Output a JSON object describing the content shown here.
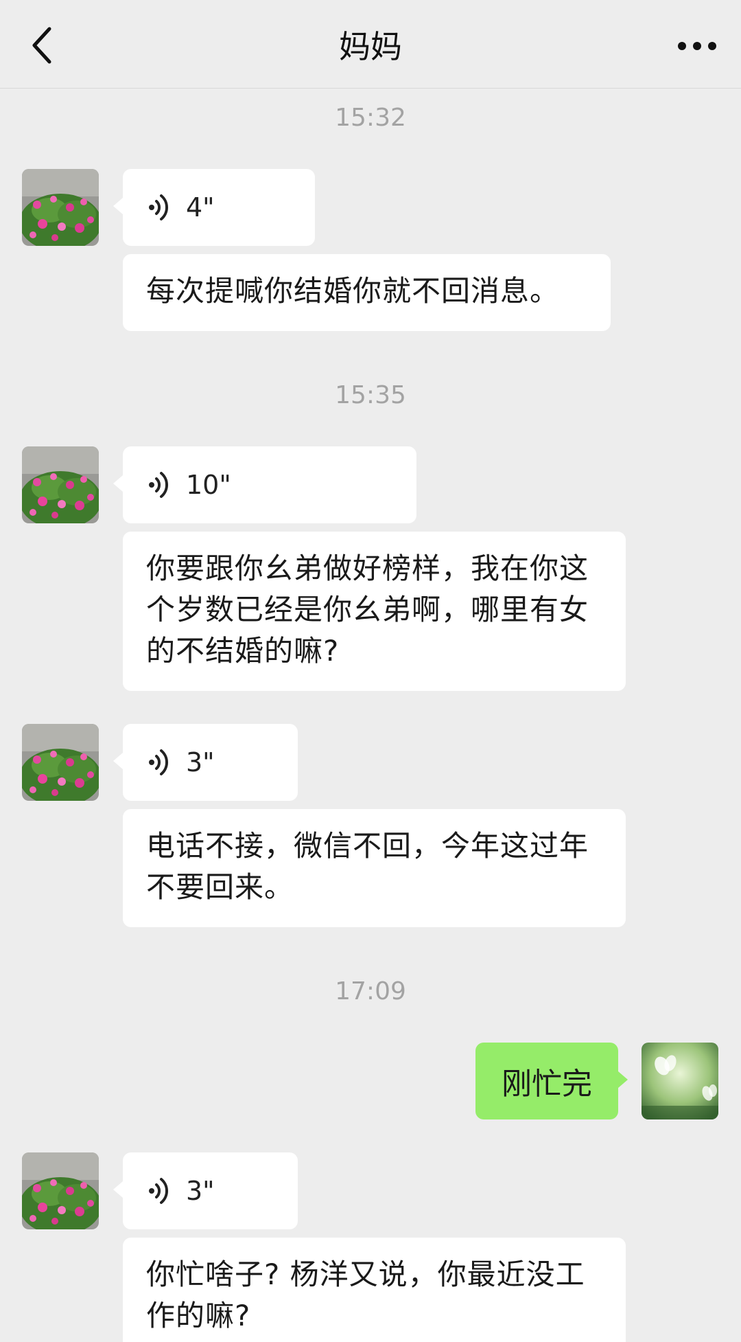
{
  "header": {
    "title": "妈妈",
    "back_icon": "chevron-left-icon",
    "more_icon": "more-dots-icon"
  },
  "timestamps": [
    "15:32",
    "15:35",
    "17:09"
  ],
  "messages": [
    {
      "voice_duration": "4\"",
      "text": "每次提喊你结婚你就不回消息。"
    },
    {
      "voice_duration": "10\"",
      "text": "你要跟你幺弟做好榜样，我在你这个岁数已经是你幺弟啊，哪里有女的不结婚的嘛?"
    },
    {
      "voice_duration": "3\"",
      "text": "电话不接，微信不回，今年这过年不要回来。"
    },
    {
      "mine_text": "刚忙完"
    },
    {
      "voice_duration": "3\"",
      "text": "你忙啥子? 杨洋又说，你最近没工作的嘛?"
    }
  ],
  "colors": {
    "background": "#ededed",
    "incoming_bubble": "#ffffff",
    "outgoing_bubble": "#95ec69",
    "timestamp": "#a3a3a3"
  }
}
